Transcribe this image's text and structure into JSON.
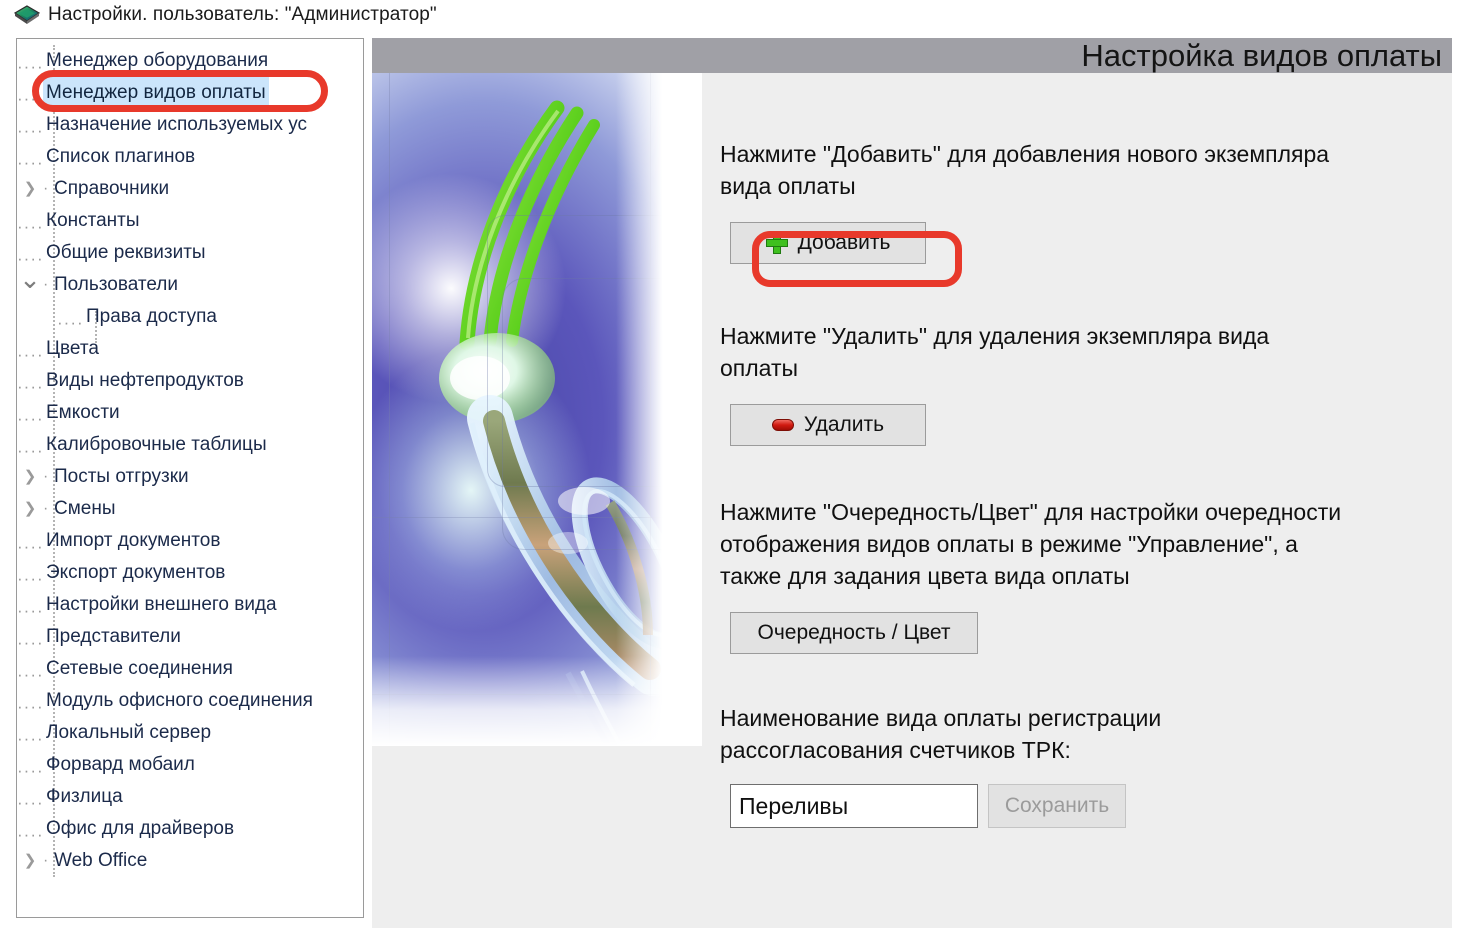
{
  "window": {
    "title": "Настройки. пользователь: \"Администратор\"",
    "icon": "diamond-app-icon"
  },
  "sidebar": {
    "items": [
      {
        "label": "Менеджер оборудования",
        "marker": "dots",
        "indent": 1,
        "selected": false
      },
      {
        "label": "Менеджер видов оплаты",
        "marker": "dots",
        "indent": 1,
        "selected": true
      },
      {
        "label": "Назначение используемых ус",
        "marker": "dots",
        "indent": 1,
        "selected": false
      },
      {
        "label": "Список плагинов",
        "marker": "dots",
        "indent": 1,
        "selected": false
      },
      {
        "label": "Справочники",
        "marker": "collapsed",
        "indent": 1,
        "selected": false
      },
      {
        "label": "Константы",
        "marker": "dots",
        "indent": 1,
        "selected": false
      },
      {
        "label": "Общие реквизиты",
        "marker": "dots",
        "indent": 1,
        "selected": false
      },
      {
        "label": "Пользователи",
        "marker": "expanded",
        "indent": 1,
        "selected": false
      },
      {
        "label": "Права доступа",
        "marker": "dots",
        "indent": 2,
        "selected": false
      },
      {
        "label": "Цвета",
        "marker": "dots",
        "indent": 1,
        "selected": false
      },
      {
        "label": "Виды нефтепродуктов",
        "marker": "dots",
        "indent": 1,
        "selected": false
      },
      {
        "label": "Емкости",
        "marker": "dots",
        "indent": 1,
        "selected": false
      },
      {
        "label": "Калибровочные таблицы",
        "marker": "dots",
        "indent": 1,
        "selected": false
      },
      {
        "label": "Посты отгрузки",
        "marker": "collapsed",
        "indent": 1,
        "selected": false
      },
      {
        "label": "Смены",
        "marker": "collapsed",
        "indent": 1,
        "selected": false
      },
      {
        "label": "Импорт документов",
        "marker": "dots",
        "indent": 1,
        "selected": false
      },
      {
        "label": "Экспорт документов",
        "marker": "dots",
        "indent": 1,
        "selected": false
      },
      {
        "label": "Настройки внешнего вида",
        "marker": "dots",
        "indent": 1,
        "selected": false
      },
      {
        "label": "Представители",
        "marker": "dots",
        "indent": 1,
        "selected": false
      },
      {
        "label": "Сетевые соединения",
        "marker": "dots",
        "indent": 1,
        "selected": false
      },
      {
        "label": "Модуль офисного соединения",
        "marker": "dots",
        "indent": 1,
        "selected": false
      },
      {
        "label": "Локальный сервер",
        "marker": "dots",
        "indent": 1,
        "selected": false
      },
      {
        "label": "Форвард мобаил",
        "marker": "dots",
        "indent": 1,
        "selected": false
      },
      {
        "label": "Физлица",
        "marker": "dots",
        "indent": 1,
        "selected": false
      },
      {
        "label": "Офис для драйверов",
        "marker": "dots",
        "indent": 1,
        "selected": false
      },
      {
        "label": "Web Office",
        "marker": "collapsed",
        "indent": 1,
        "selected": false
      }
    ]
  },
  "content": {
    "header_title": "Настройка видов оплаты",
    "add_section": {
      "description": "Нажмите \"Добавить\" для добавления нового экземпляра вида оплаты",
      "button_label": "Добавить",
      "button_icon": "plus-icon"
    },
    "delete_section": {
      "description": "Нажмите \"Удалить\" для удаления экземпляра вида оплаты",
      "button_label": "Удалить",
      "button_icon": "minus-icon"
    },
    "order_color_section": {
      "description": "Нажмите \"Очередность/Цвет\" для настройки очередности отображения видов оплаты в режиме \"Управление\", а также для задания цвета вида оплаты",
      "button_label": "Очередность / Цвет"
    },
    "name_section": {
      "label": "Наименование вида оплаты регистрации рассогласования счетчиков ТРК:",
      "input_value": "Переливы",
      "input_placeholder": "",
      "save_label": "Сохранить"
    }
  },
  "annotations": {
    "color": "#e8392b",
    "targets": [
      "sidebar-item-menedzher-vidov-oplaty",
      "add-button"
    ]
  },
  "colors": {
    "header_bar": "#a0a0a6",
    "content_background": "#eeeeee",
    "selection": "#cbe5fb",
    "annotation_red": "#e8392b",
    "plus_green": "#3fc01f",
    "minus_red": "#d11a10"
  }
}
